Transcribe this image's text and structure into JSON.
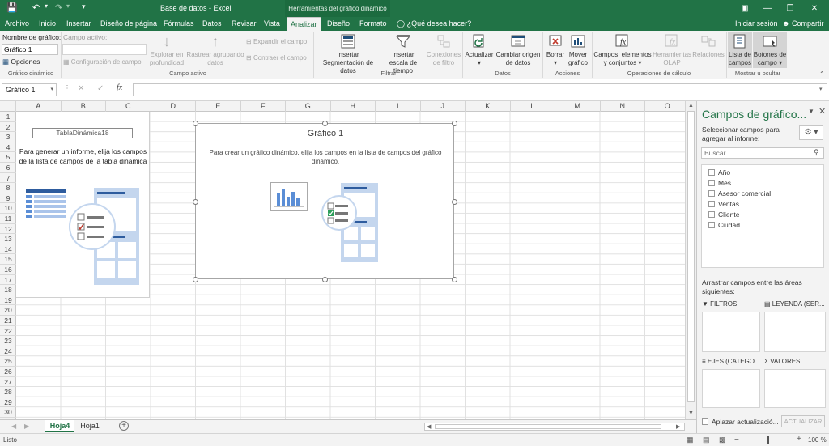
{
  "title_bar": {
    "app_title": "Base de datos - Excel",
    "context_title": "Herramientas del gráfico dinámico",
    "sign_in": "Iniciar sesión",
    "share": "Compartir"
  },
  "tabs": [
    "Archivo",
    "Inicio",
    "Insertar",
    "Diseño de página",
    "Fórmulas",
    "Datos",
    "Revisar",
    "Vista",
    "Analizar",
    "Diseño",
    "Formato"
  ],
  "tell_me": "¿Qué desea hacer?",
  "ribbon": {
    "chart_name_label": "Nombre de gráfico:",
    "chart_name_value": "Gráfico 1",
    "options": "Opciones",
    "group_chart": "Gráfico dinámico",
    "active_field_label": "Campo activo:",
    "field_config": "Configuración de campo",
    "drill_down": "Explorar en profundidad",
    "drill_up": "Rastrear agrupando datos",
    "expand_field": "Expandir el campo",
    "collapse_field": "Contraer el campo",
    "group_active": "Campo activo",
    "insert_slicer": "Insertar Segmentación de datos",
    "insert_timeline": "Insertar escala de tiempo",
    "filter_connections": "Conexiones de filtro",
    "group_filter": "Filtrar",
    "refresh": "Actualizar",
    "change_source": "Cambiar origen de datos",
    "group_data": "Datos",
    "clear": "Borrar",
    "move_chart": "Mover gráfico",
    "group_actions": "Acciones",
    "fields_items": "Campos, elementos y conjuntos",
    "olap_tools": "Herramientas OLAP",
    "relations": "Relaciones",
    "group_calc": "Operaciones de cálculo",
    "field_list": "Lista de campos",
    "field_buttons": "Botones de campo",
    "group_show": "Mostrar u ocultar"
  },
  "formula_bar": {
    "name_box": "Gráfico 1",
    "fx": "fx"
  },
  "columns": [
    "A",
    "B",
    "C",
    "D",
    "E",
    "F",
    "G",
    "H",
    "I",
    "J",
    "K",
    "L",
    "M",
    "N",
    "O"
  ],
  "rows": [
    "1",
    "2",
    "3",
    "4",
    "5",
    "6",
    "7",
    "8",
    "9",
    "10",
    "11",
    "12",
    "13",
    "14",
    "15",
    "16",
    "17",
    "18",
    "19",
    "20",
    "21",
    "22",
    "23",
    "24",
    "25",
    "26",
    "27",
    "28",
    "29",
    "30"
  ],
  "pivot_table": {
    "name": "TablaDinámica18",
    "instruction": "Para generar un informe, elija los campos de la lista de campos de la tabla dinámica"
  },
  "chart": {
    "title": "Gráfico 1",
    "instruction": "Para crear un gráfico dinámico, elija los campos en la lista de campos del gráfico dinámico."
  },
  "sheets": [
    "Hoja4",
    "Hoja1"
  ],
  "status": {
    "ready": "Listo",
    "zoom": "100 %"
  },
  "pane": {
    "title": "Campos de gráfico...",
    "choose_fields": "Seleccionar campos para agregar al informe:",
    "search_placeholder": "Buscar",
    "fields": [
      "Año",
      "Mes",
      "Asesor comercial",
      "Ventas",
      "Cliente",
      "Ciudad"
    ],
    "drag_text": "Arrastrar campos entre las áreas siguientes:",
    "area_filters": "FILTROS",
    "area_legend": "LEYENDA (SER...",
    "area_axes": "EJES (CATEGO...",
    "area_values": "VALORES",
    "defer_update": "Aplazar actualizació...",
    "update_button": "ACTUALIZAR"
  },
  "colors": {
    "excel_green": "#217346",
    "accent": "#1f4e79"
  }
}
